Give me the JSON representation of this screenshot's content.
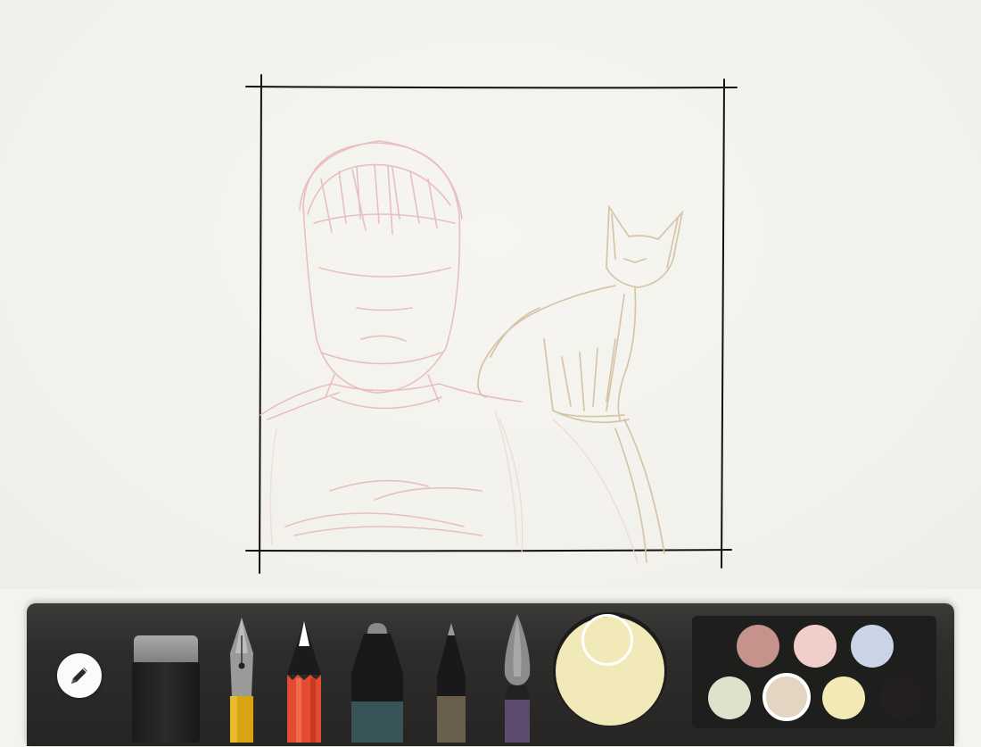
{
  "app": {
    "accent_color": "#262523"
  },
  "toolbar": {
    "mode_icon": "pencil-icon",
    "tools": [
      {
        "id": "eraser",
        "icon": "eraser-icon"
      },
      {
        "id": "fountain-pen",
        "icon": "fountain-pen-icon",
        "color": "#d8a414"
      },
      {
        "id": "pencil",
        "icon": "pencil-icon",
        "color": "#e44b30"
      },
      {
        "id": "marker",
        "icon": "marker-icon",
        "color": "#385458"
      },
      {
        "id": "fine-pen",
        "icon": "fine-pen-icon",
        "color": "#6a5e4c"
      },
      {
        "id": "brush",
        "icon": "brush-icon",
        "color": "#5d4a6e"
      }
    ],
    "current_color": "#f2e9b8",
    "palette": [
      {
        "color": "#c5938b"
      },
      {
        "color": "#f0cfcb"
      },
      {
        "color": "#c9d4e7"
      },
      {
        "color": "#dfe1cd"
      },
      {
        "color": "#e4d4c2",
        "selected": true
      },
      {
        "color": "#f2e9b4"
      },
      {
        "color": "#231f20"
      }
    ]
  },
  "drawing": {
    "subjects": [
      "person-sketch",
      "cat-sketch"
    ],
    "person_color": "#eab8bb",
    "cat_color": "#d9c7ae",
    "frame_color": "#111111"
  }
}
